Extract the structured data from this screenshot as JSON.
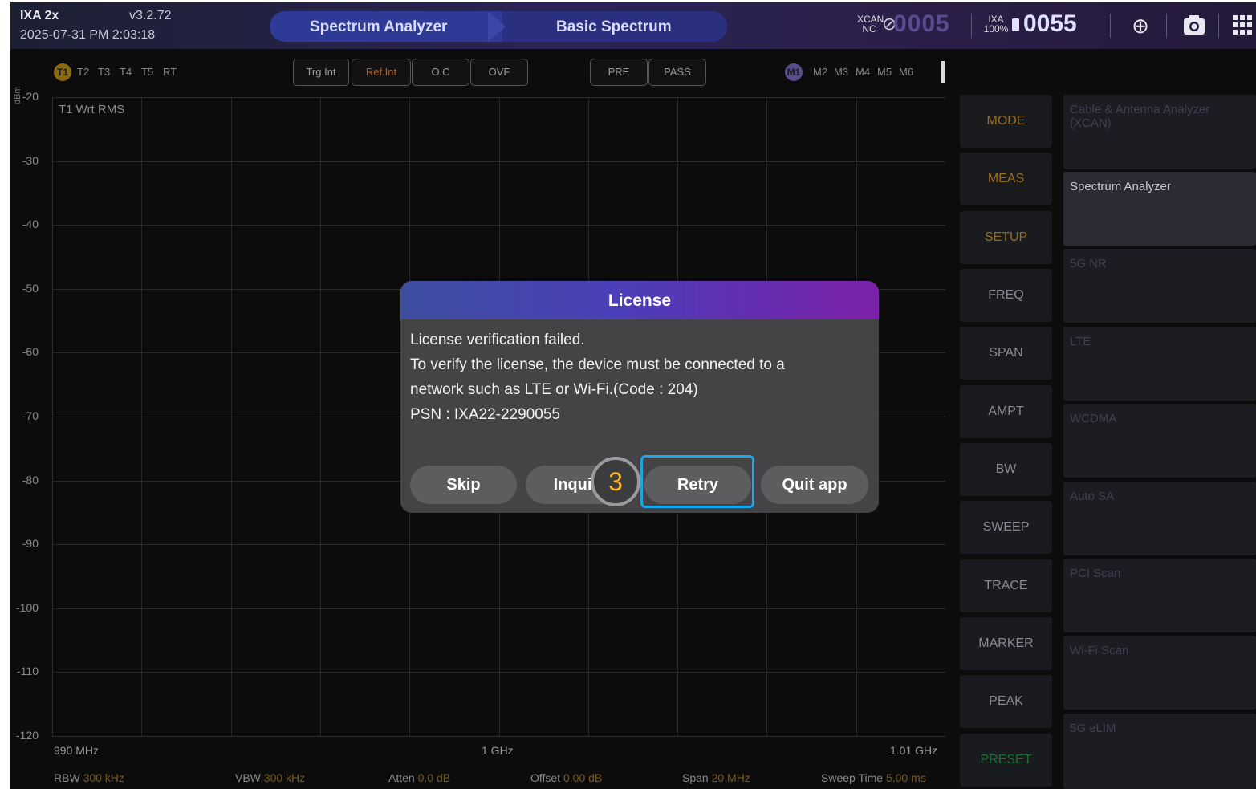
{
  "device": {
    "name": "IXA 2x",
    "version": "v3.2.72",
    "datetime": "2025-07-31 PM 2:03:18"
  },
  "mode_bar": {
    "mode": "Spectrum Analyzer",
    "measurement": "Basic Spectrum"
  },
  "status": {
    "xcan_label": "XCAN",
    "xcan_sub": "NC",
    "xcan_code": "0005",
    "ixa_label": "IXA",
    "ixa_battery": "100%",
    "ixa_code": "0055"
  },
  "traces": [
    "T1",
    "T2",
    "T3",
    "T4",
    "T5",
    "RT"
  ],
  "status_buttons": [
    "Trg.Int",
    "Ref.Int",
    "O.C",
    "OVF",
    "PRE",
    "PASS"
  ],
  "markers": [
    "M1",
    "M2",
    "M3",
    "M4",
    "M5",
    "M6"
  ],
  "graph": {
    "unit": "dBm",
    "trace_label": "T1 Wrt RMS",
    "y_ticks": [
      "-20",
      "-30",
      "-40",
      "-50",
      "-60",
      "-70",
      "-80",
      "-90",
      "-100",
      "-110",
      "-120"
    ],
    "x_start": "990 MHz",
    "x_center": "1 GHz",
    "x_end": "1.01 GHz"
  },
  "bottom_params": [
    {
      "label": "RBW",
      "value": "300 kHz"
    },
    {
      "label": "VBW",
      "value": "300 kHz"
    },
    {
      "label": "Atten",
      "value": "0.0 dB"
    },
    {
      "label": "Offset",
      "value": "0.00 dB"
    },
    {
      "label": "Span",
      "value": "20 MHz"
    },
    {
      "label": "Sweep Time",
      "value": "5.00 ms"
    }
  ],
  "softkeys": [
    "MODE",
    "MEAS",
    "SETUP",
    "FREQ",
    "SPAN",
    "AMPT",
    "BW",
    "SWEEP",
    "TRACE",
    "MARKER",
    "PEAK",
    "PRESET"
  ],
  "menu_items": [
    "Cable & Antenna Analyzer (XCAN)",
    "Spectrum Analyzer",
    "5G NR",
    "LTE",
    "WCDMA",
    "Auto SA",
    "PCI Scan",
    "Wi-Fi Scan",
    "5G eLIM"
  ],
  "dialog": {
    "title": "License",
    "line1": "License verification failed.",
    "line2": "To verify the license, the device must be connected to a",
    "line3": "network such as LTE or Wi-Fi.(Code : 204)",
    "line4": "PSN : IXA22-2290055",
    "buttons": {
      "skip": "Skip",
      "inquiry": "Inquiry",
      "retry": "Retry",
      "quit": "Quit app"
    }
  },
  "step_number": "3"
}
